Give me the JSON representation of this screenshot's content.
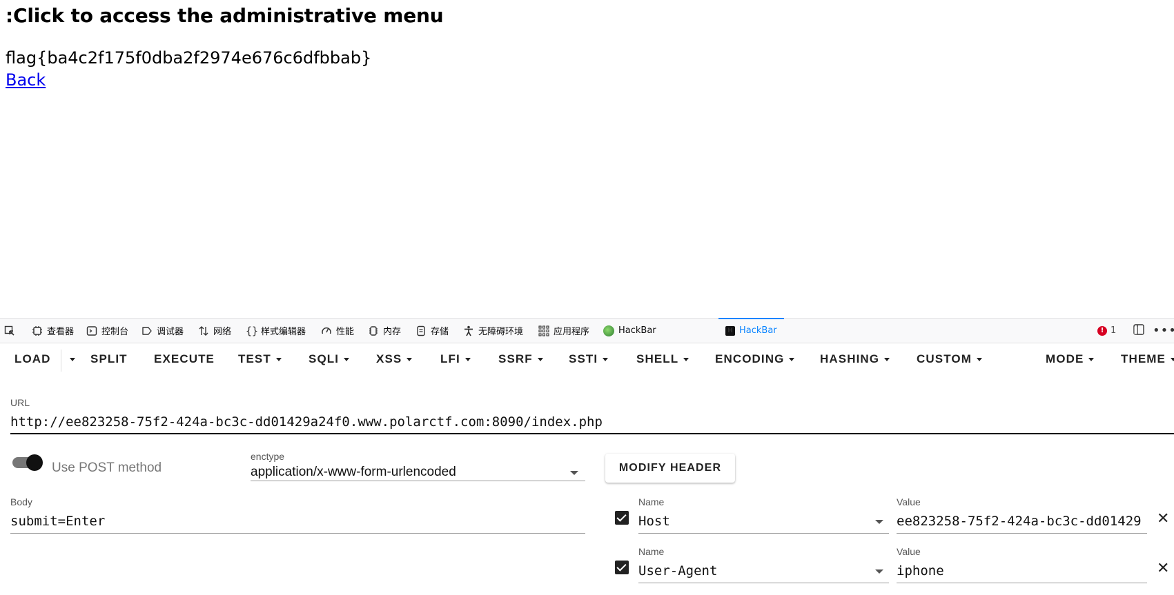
{
  "page": {
    "heading": ":Click to access the administrative menu",
    "flag": "flag{ba4c2f175f0dba2f2974e676c6dfbbab}",
    "back_link": "Back"
  },
  "devtools": {
    "tabs": [
      {
        "label": "查看器",
        "icon": "inspector-icon"
      },
      {
        "label": "控制台",
        "icon": "console-icon"
      },
      {
        "label": "调试器",
        "icon": "debugger-icon"
      },
      {
        "label": "网络",
        "icon": "network-icon"
      },
      {
        "label": "样式编辑器",
        "icon": "style-editor-icon"
      },
      {
        "label": "性能",
        "icon": "performance-icon"
      },
      {
        "label": "内存",
        "icon": "memory-icon"
      },
      {
        "label": "存储",
        "icon": "storage-icon"
      },
      {
        "label": "无障碍环境",
        "icon": "accessibility-icon"
      },
      {
        "label": "应用程序",
        "icon": "application-icon"
      },
      {
        "label": "HackBar",
        "icon": "hackbar-green-icon"
      },
      {
        "label": "HackBar",
        "icon": "hackbar-icon",
        "active": true
      }
    ],
    "error_count": "1"
  },
  "hackbar": {
    "menu": {
      "load": "LOAD",
      "split": "SPLIT",
      "execute": "EXECUTE",
      "test": "TEST",
      "sqli": "SQLI",
      "xss": "XSS",
      "lfi": "LFI",
      "ssrf": "SSRF",
      "ssti": "SSTI",
      "shell": "SHELL",
      "encoding": "ENCODING",
      "hashing": "HASHING",
      "custom": "CUSTOM",
      "mode": "MODE",
      "theme": "THEME"
    },
    "url_label": "URL",
    "url_value": "http://ee823258-75f2-424a-bc3c-dd01429a24f0.www.polarctf.com:8090/index.php",
    "post_toggle_label": "Use POST method",
    "post_enabled": true,
    "enctype_label": "enctype",
    "enctype_value": "application/x-www-form-urlencoded",
    "modify_header_button": "MODIFY HEADER",
    "body_label": "Body",
    "body_value": "submit=Enter",
    "headers": [
      {
        "enabled": true,
        "name_label": "Name",
        "name": "Host",
        "value_label": "Value",
        "value": "ee823258-75f2-424a-bc3c-dd01429"
      },
      {
        "enabled": true,
        "name_label": "Name",
        "name": "User-Agent",
        "value_label": "Value",
        "value": "iphone"
      }
    ]
  }
}
